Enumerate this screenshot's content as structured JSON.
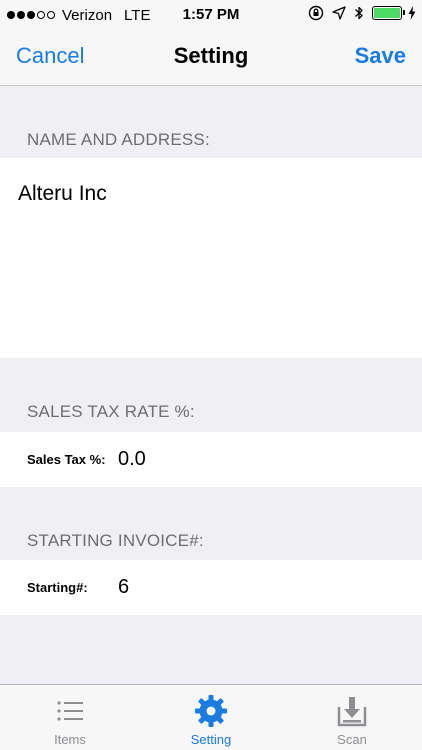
{
  "status_bar": {
    "carrier": "Verizon",
    "network": "LTE",
    "time": "1:57 PM",
    "battery_level": 1.0
  },
  "nav": {
    "cancel_label": "Cancel",
    "title": "Setting",
    "save_label": "Save"
  },
  "sections": {
    "name_address": {
      "header": "NAME AND ADDRESS:",
      "value": "Alteru Inc"
    },
    "sales_tax": {
      "header": "SALES TAX RATE %:",
      "label": "Sales Tax %:",
      "value": "0.0"
    },
    "invoice": {
      "header": "STARTING INVOICE#:",
      "label": "Starting#:",
      "value": "6"
    }
  },
  "tab_bar": {
    "tabs": [
      {
        "label": "Items",
        "icon": "list-icon",
        "active": false
      },
      {
        "label": "Setting",
        "icon": "gear-icon",
        "active": true
      },
      {
        "label": "Scan",
        "icon": "download-icon",
        "active": false
      }
    ]
  },
  "colors": {
    "accent": "#1a7be0",
    "background": "#efeff4",
    "battery": "#4cd964",
    "inactive": "#8e8e93"
  }
}
